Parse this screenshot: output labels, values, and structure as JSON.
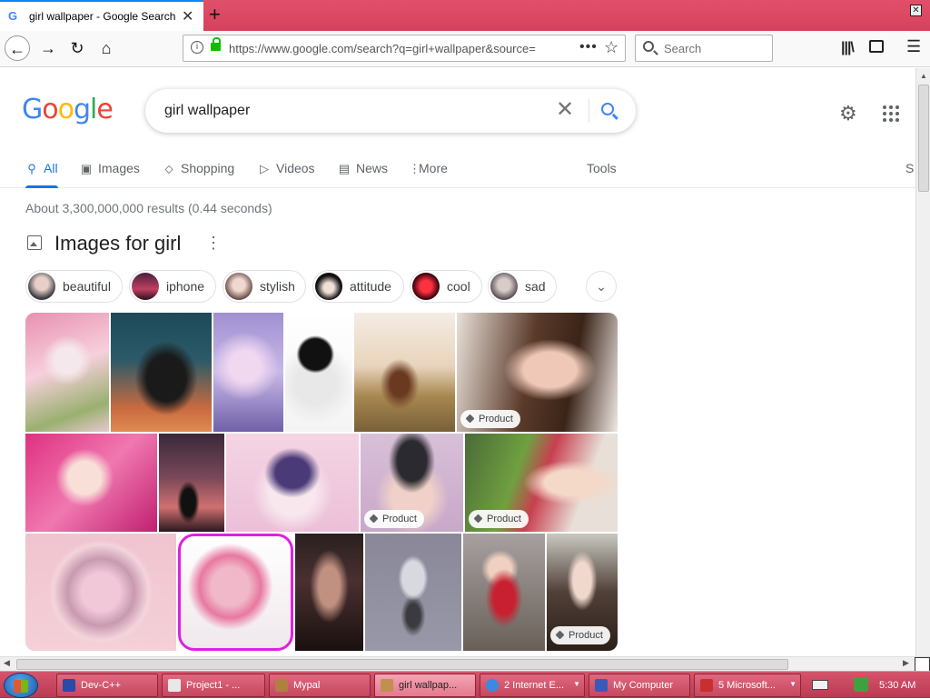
{
  "browser": {
    "tab_title": "girl wallpaper - Google Search",
    "tab_favicon": "G",
    "new_tab_symbol": "+",
    "url": "https://www.google.com/search?q=girl+wallpaper&source=",
    "search_placeholder": "Search",
    "icons": [
      "back-icon",
      "forward-icon",
      "reload-icon",
      "home-icon",
      "info-icon",
      "lock-icon",
      "page-actions-icon",
      "bookmark-star-icon",
      "library-icon",
      "sidebar-icon",
      "menu-icon"
    ]
  },
  "google": {
    "logo": [
      "G",
      "o",
      "o",
      "g",
      "l",
      "e"
    ],
    "logo_colors": [
      "#4285f4",
      "#ea4335",
      "#fbbc05",
      "#4285f4",
      "#34a853",
      "#ea4335"
    ],
    "query": "girl wallpaper",
    "tabs": [
      {
        "label": "All",
        "icon": "search-icon",
        "active": true
      },
      {
        "label": "Images",
        "icon": "image-icon"
      },
      {
        "label": "Shopping",
        "icon": "tag-icon"
      },
      {
        "label": "Videos",
        "icon": "play-icon"
      },
      {
        "label": "News",
        "icon": "news-icon"
      },
      {
        "label": "More",
        "icon": "more-vert-icon"
      }
    ],
    "tools": "Tools",
    "safesearch_partial": "S",
    "stats": "About 3,300,000,000 results (0.44 seconds)",
    "images_heading": "Images for girl",
    "chips": [
      "beautiful",
      "iphone",
      "stylish",
      "attitude",
      "cool",
      "sad"
    ],
    "badge_label": "Product",
    "accent": "#1a73e8"
  },
  "taskbar": {
    "items": [
      {
        "label": "Dev-C++"
      },
      {
        "label": "Project1 - ..."
      },
      {
        "label": "Mypal"
      },
      {
        "label": "girl wallpap...",
        "active": true
      },
      {
        "label": "2 Internet E..."
      },
      {
        "label": "My Computer"
      },
      {
        "label": "5 Microsoft..."
      }
    ],
    "clock": "5:30 AM"
  }
}
